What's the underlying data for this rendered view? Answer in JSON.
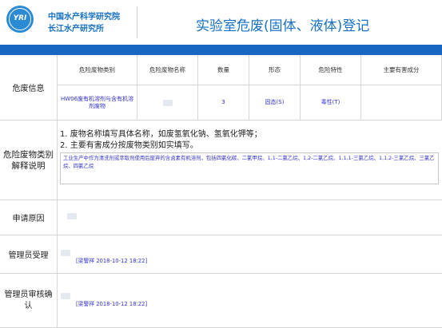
{
  "header": {
    "logo_text": "YRI",
    "org_line1": "中国水产科学研究院",
    "org_line2": "长江水产研究所",
    "title": "实验室危废(固体、液体)登记"
  },
  "table": {
    "row_labels": {
      "info": "危废信息",
      "explain": "危险废物类别解释说明",
      "reason": "申请原因",
      "admin_accept": "管理员受理",
      "admin_review": "管理员审核确认"
    },
    "columns": [
      "危险废物类别",
      "危险废物名称",
      "数量",
      "形态",
      "危险特性",
      "主要有害成分"
    ],
    "row": {
      "category": "HW06废有机溶剂与含有机溶剂废物",
      "name": "",
      "quantity": "3",
      "form": "固态(S)",
      "hazard": "毒性(T)",
      "harmful": ""
    },
    "notes": [
      "1. 废物名称填写具体名称，如废氢氧化钠、氢氧化钾等；",
      "2. 主要有害成分按废物类别如实填写。"
    ],
    "explanation_text": "工业生产中作为清洗剂或萃取剂使用后废弃的含卤素有机溶剂，包括四氯化碳、二氯甲烷、1,1-二氯乙烷、1,2-二氯乙烷、1,1,1-三氯乙烷、1,1,2-三氯乙烷、三氯乙烷、四氯乙烷",
    "accept_sig": "[梁警祥 2018-10-12 18:22]",
    "review_sig": "[梁警祥 2018-10-12 18:22]"
  }
}
